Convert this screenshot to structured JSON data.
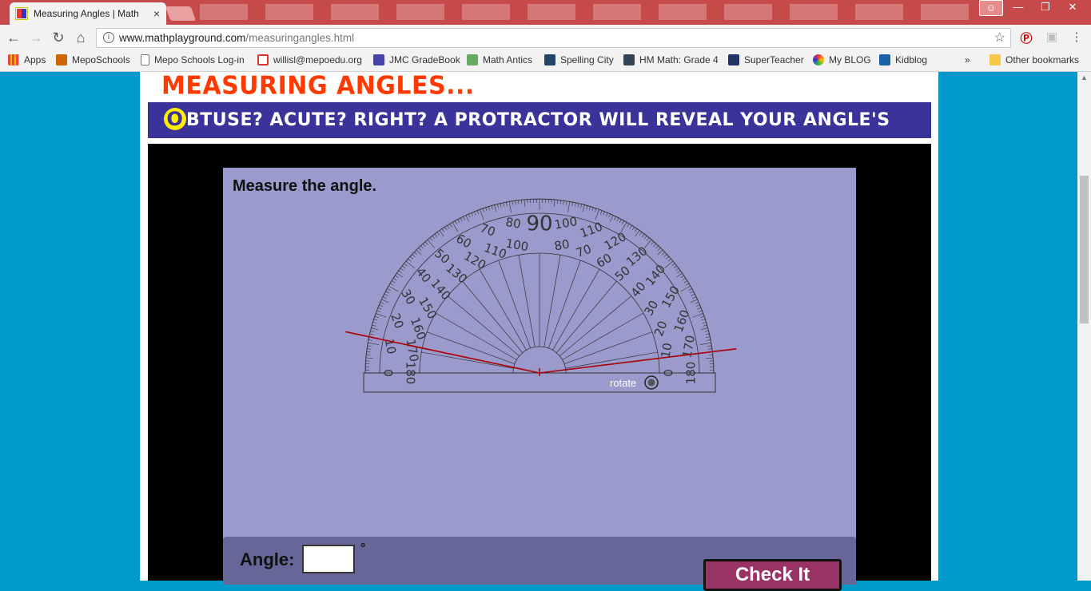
{
  "browser": {
    "tab_title": "Measuring Angles | Math",
    "tab_close": "×",
    "url_host": "www.mathplayground.com",
    "url_path": "/measuringangles.html",
    "bookmarks": [
      "Apps",
      "MepoSchools",
      "Mepo Schools Log-in",
      "willisl@mepoedu.org",
      "JMC GradeBook",
      "Math Antics",
      "Spelling City",
      "HM Math: Grade 4",
      "SuperTeacher",
      "My BLOG",
      "Kidblog"
    ],
    "bookmarks_more": "»",
    "other_bookmarks": "Other bookmarks"
  },
  "page": {
    "headline": "MEASURING ANGLES...",
    "banner_first": "O",
    "banner_rest": "BTUSE? ACUTE? RIGHT? A PROTRACTOR WILL REVEAL YOUR ANGLE'S TYPE!"
  },
  "game": {
    "prompt": "Measure the angle.",
    "rotate_label": "rotate",
    "angle_label": "Angle:",
    "angle_value": "",
    "degree_symbol": "°",
    "check_button": "Check It",
    "protractor_center_label": "90",
    "ray_angles_deg": [
      168,
      7
    ]
  },
  "colors": {
    "page_bg": "#0099cc",
    "headline": "#ff3a00",
    "banner_bg": "#3a3399",
    "stage_bg": "#9a9acd",
    "ray": "#aa0000",
    "check_bg": "#993366"
  }
}
